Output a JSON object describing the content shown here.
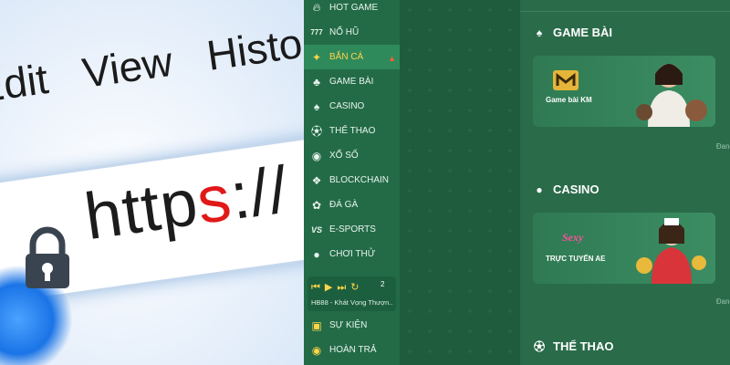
{
  "photo": {
    "menu_items": [
      "Edit",
      "View",
      "Histo"
    ],
    "url_scheme": "http",
    "url_scheme_secure": "s",
    "url_rest": "://"
  },
  "sidebar": {
    "items": [
      {
        "label": "HOT GAME",
        "icon": "flame-icon"
      },
      {
        "label": "NỔ HŨ",
        "icon": "slot-777-icon"
      },
      {
        "label": "BẮN CÁ",
        "icon": "fish-icon",
        "active": true,
        "badge": "hot-badge-icon"
      },
      {
        "label": "GAME BÀI",
        "icon": "cards-icon"
      },
      {
        "label": "CASINO",
        "icon": "dealer-icon"
      },
      {
        "label": "THỂ THAO",
        "icon": "soccer-ball-icon"
      },
      {
        "label": "XỔ SỐ",
        "icon": "eye-icon"
      },
      {
        "label": "BLOCKCHAIN",
        "icon": "blockchain-icon"
      },
      {
        "label": "ĐÁ GÀ",
        "icon": "rooster-icon"
      },
      {
        "label": "E-SPORTS",
        "icon": "vs-icon"
      },
      {
        "label": "CHƠI THỬ",
        "icon": "gamepad-icon"
      }
    ],
    "player": {
      "count": "2",
      "song": "HB88 - Khát Vọng Thượn..."
    },
    "bottom_items": [
      {
        "label": "SỰ KIỆN",
        "icon": "gift-icon"
      },
      {
        "label": "HOÀN TRẢ",
        "icon": "coin-icon"
      }
    ]
  },
  "content": {
    "sections": [
      {
        "title": "GAME BÀI",
        "icon": "cards-icon",
        "card_label": "Game bài KM",
        "note": "Đang"
      },
      {
        "title": "CASINO",
        "icon": "dealer-avatar-icon",
        "card_label": "TRỰC TUYẾN AE",
        "card_brand": "Sexy",
        "note": "Đang"
      },
      {
        "title": "THỂ THAO",
        "icon": "soccer-ball-icon"
      }
    ]
  },
  "colors": {
    "accent": "#ffd54a",
    "sidebar_bg": "#236b47",
    "active_bg": "#2f8a5b",
    "content_bg": "#2a6b4a"
  }
}
